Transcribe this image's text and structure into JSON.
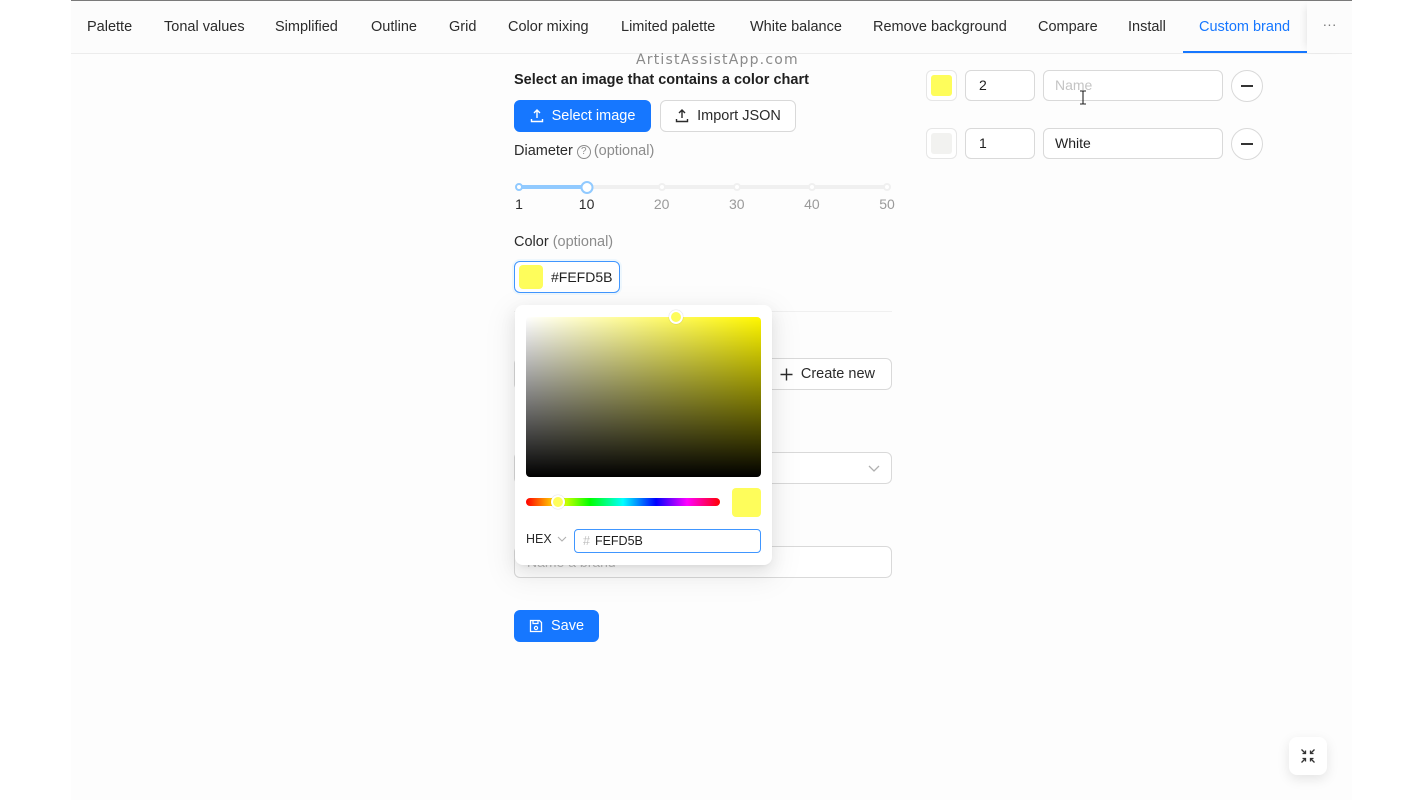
{
  "tabs": [
    {
      "label": "Palette",
      "active": false
    },
    {
      "label": "Tonal values",
      "active": false
    },
    {
      "label": "Simplified",
      "active": false
    },
    {
      "label": "Outline",
      "active": false
    },
    {
      "label": "Grid",
      "active": false
    },
    {
      "label": "Color mixing",
      "active": false
    },
    {
      "label": "Limited palette",
      "active": false
    },
    {
      "label": "White balance",
      "active": false
    },
    {
      "label": "Remove background",
      "active": false
    },
    {
      "label": "Compare",
      "active": false
    },
    {
      "label": "Install",
      "active": false
    },
    {
      "label": "Custom brand",
      "active": true
    }
  ],
  "more_tabs": "···",
  "watermark": "ArtistAssistApp.com",
  "form": {
    "heading": "Select an image that contains a color chart",
    "select_image_label": "Select image",
    "import_json_label": "Import JSON",
    "diameter_label": "Diameter",
    "optional": "(optional)",
    "diameter": {
      "min": 1,
      "max": 50,
      "value": 10,
      "marks": [
        "1",
        "10",
        "20",
        "30",
        "40",
        "50"
      ]
    },
    "color_label": "Color",
    "color_value": "#FEFD5B",
    "create_new_label": "Create new",
    "brand_placeholder": "Name a brand",
    "save_label": "Save"
  },
  "color_picker": {
    "format": "HEX",
    "hash": "#",
    "hex_value": "FEFD5B",
    "color": "#FEFD5B",
    "hue_color": "#FFF700",
    "hue_degrees": 60,
    "saturation": 0.64,
    "brightness": 1.0
  },
  "color_rows": [
    {
      "swatch": "#FEFD5B",
      "quantity": "2",
      "name": "",
      "name_placeholder": "Name"
    },
    {
      "swatch": "#F2F2F0",
      "quantity": "1",
      "name": "White",
      "name_placeholder": "Name"
    }
  ],
  "float_button": "exit-fullscreen"
}
